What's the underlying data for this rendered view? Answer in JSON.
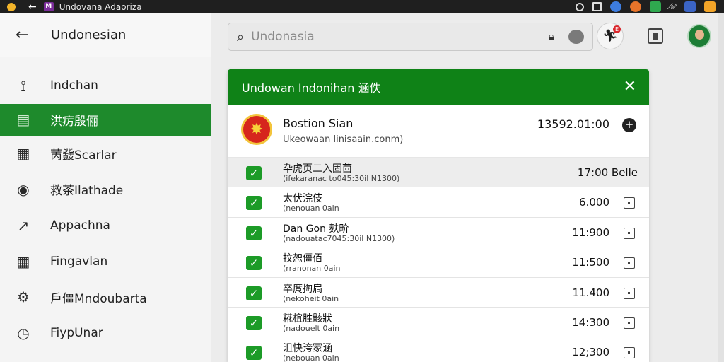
{
  "window": {
    "title": "Undovana Adaoriza"
  },
  "sidebar": {
    "header": "Undonesian",
    "items": [
      {
        "label": "Indchan",
        "icon": "route-icon"
      },
      {
        "label": "洪疠殷俪",
        "icon": "inbox-icon",
        "active": true
      },
      {
        "label": "苪鼗Scarlar",
        "icon": "calendar-icon"
      },
      {
        "label": "救茶Ilathade",
        "icon": "target-icon"
      },
      {
        "label": "Appachna",
        "icon": "edit-icon"
      },
      {
        "label": "Fingavlan",
        "icon": "grid-calendar-icon"
      },
      {
        "label": "戶僵Mndoubarta",
        "icon": "gear-icon"
      },
      {
        "label": "FiypUnar",
        "icon": "clock-icon"
      }
    ]
  },
  "search": {
    "placeholder": "Undonasia"
  },
  "colors": {
    "accent": "#1e8a2c",
    "header_green": "#0f8217"
  },
  "modal": {
    "title": "Undowan Indonihan 涵佚",
    "contact": {
      "name": "Bostion Sian",
      "email": "Ukeowaan linisaain.conm)",
      "amount": "13592.01:00"
    },
    "rows": [
      {
        "title": "卆虎页二入固茴",
        "sub": "(ifekaranac to045:30il N1300)",
        "value": "17:00 Belle"
      },
      {
        "title": "太伏浣伎",
        "sub": "(nenouan 0ain",
        "value": "6.000"
      },
      {
        "title": "Dan Gon 麸畍",
        "sub": "(nadouatac7045:30il N1300)",
        "value": "11:900"
      },
      {
        "title": "抆㤎僵佰",
        "sub": "(rranonan 0ain",
        "value": "11:500"
      },
      {
        "title": "卒庹掏扃",
        "sub": "(nekoheit 0ain",
        "value": "11.400"
      },
      {
        "title": "糀椬胜骸狀",
        "sub": "(nadouelt 0ain",
        "value": "14:300"
      },
      {
        "title": "沮快洿冡涵",
        "sub": "(nebouan 0ain",
        "value": "12;300"
      }
    ]
  }
}
